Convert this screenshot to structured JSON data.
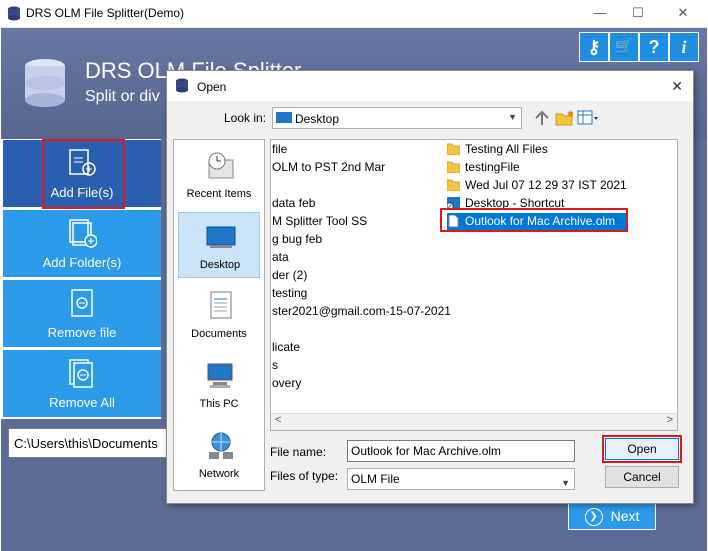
{
  "main_window": {
    "title": "DRS OLM File Splitter(Demo)",
    "controls": {
      "minimize": "—",
      "maximize": "☐",
      "close": "✕"
    },
    "banner_title": "DRS OLM File Splitter",
    "banner_subtitle": "Split or div",
    "toolbar": {
      "key": "⚷",
      "cart": "🛒",
      "help": "?",
      "info": "i"
    },
    "side_buttons": [
      {
        "label": "Add File(s)"
      },
      {
        "label": "Add Folder(s)"
      },
      {
        "label": "Remove file"
      },
      {
        "label": "Remove All"
      }
    ],
    "path_value": "C:\\Users\\this\\Documents",
    "next_label": "Next",
    "colors": {
      "accent": "#2b9ae8",
      "banner": "#5d6c95",
      "highlight": "#e0181b"
    }
  },
  "dialog": {
    "title": "Open",
    "close": "✕",
    "look_in_label": "Look in:",
    "look_in_value": "Desktop",
    "places": [
      {
        "label": "Recent Items",
        "icon": "recent-items-icon"
      },
      {
        "label": "Desktop",
        "icon": "desktop-icon"
      },
      {
        "label": "Documents",
        "icon": "documents-icon"
      },
      {
        "label": "This PC",
        "icon": "this-pc-icon"
      },
      {
        "label": "Network",
        "icon": "network-icon"
      }
    ],
    "left_column": [
      "file",
      "OLM to PST 2nd Mar",
      "",
      "data feb",
      "M Splitter Tool SS",
      "g bug feb",
      "ata",
      "der (2)",
      "testing",
      "ster2021@gmail.com-15-07-2021",
      "",
      "licate",
      "s",
      "overy"
    ],
    "right_column": [
      {
        "name": "Testing All Files",
        "type": "folder"
      },
      {
        "name": "testingFile",
        "type": "folder"
      },
      {
        "name": "Wed Jul 07 12 29 37 IST 2021",
        "type": "folder"
      },
      {
        "name": "Desktop - Shortcut",
        "type": "shortcut"
      },
      {
        "name": "Outlook for Mac Archive.olm",
        "type": "file",
        "selected": true
      }
    ],
    "file_name_label": "File name:",
    "file_name_value": "Outlook for Mac Archive.olm",
    "files_of_type_label": "Files of type:",
    "files_of_type_value": "OLM File",
    "open_label": "Open",
    "cancel_label": "Cancel"
  }
}
